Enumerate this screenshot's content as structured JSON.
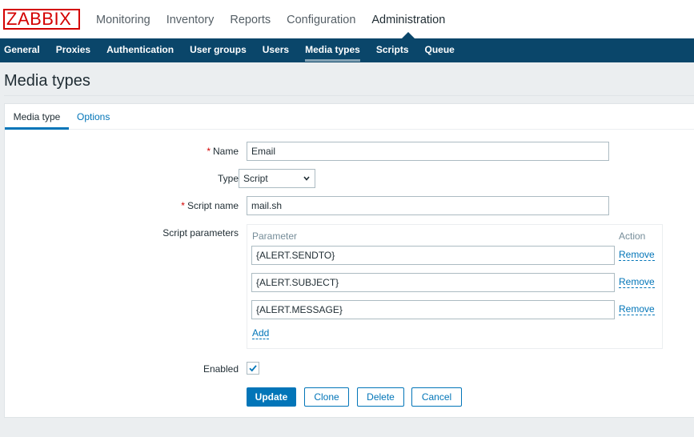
{
  "logo": "ZABBIX",
  "top_menu": [
    {
      "label": "Monitoring"
    },
    {
      "label": "Inventory"
    },
    {
      "label": "Reports"
    },
    {
      "label": "Configuration"
    },
    {
      "label": "Administration"
    }
  ],
  "top_menu_active": "Administration",
  "sub_menu": [
    {
      "label": "General"
    },
    {
      "label": "Proxies"
    },
    {
      "label": "Authentication"
    },
    {
      "label": "User groups"
    },
    {
      "label": "Users"
    },
    {
      "label": "Media types"
    },
    {
      "label": "Scripts"
    },
    {
      "label": "Queue"
    }
  ],
  "sub_menu_active": "Media types",
  "page_title": "Media types",
  "tabs": {
    "media_type": "Media type",
    "options": "Options"
  },
  "form": {
    "required_mark": "*",
    "name_label": "Name",
    "name_value": "Email",
    "type_label": "Type",
    "type_value": "Script",
    "script_name_label": "Script name",
    "script_name_value": "mail.sh",
    "script_params_label": "Script parameters",
    "params_header_parameter": "Parameter",
    "params_header_action": "Action",
    "params": [
      {
        "value": "{ALERT.SENDTO}",
        "action": "Remove"
      },
      {
        "value": "{ALERT.SUBJECT}",
        "action": "Remove"
      },
      {
        "value": "{ALERT.MESSAGE}",
        "action": "Remove"
      }
    ],
    "add_label": "Add",
    "enabled_label": "Enabled",
    "enabled_checked": true
  },
  "buttons": {
    "update": "Update",
    "clone": "Clone",
    "delete": "Delete",
    "cancel": "Cancel"
  },
  "colors": {
    "accent": "#0275b8",
    "nav_bg": "#0a466a",
    "logo_red": "#d40000",
    "required": "#d40000"
  }
}
